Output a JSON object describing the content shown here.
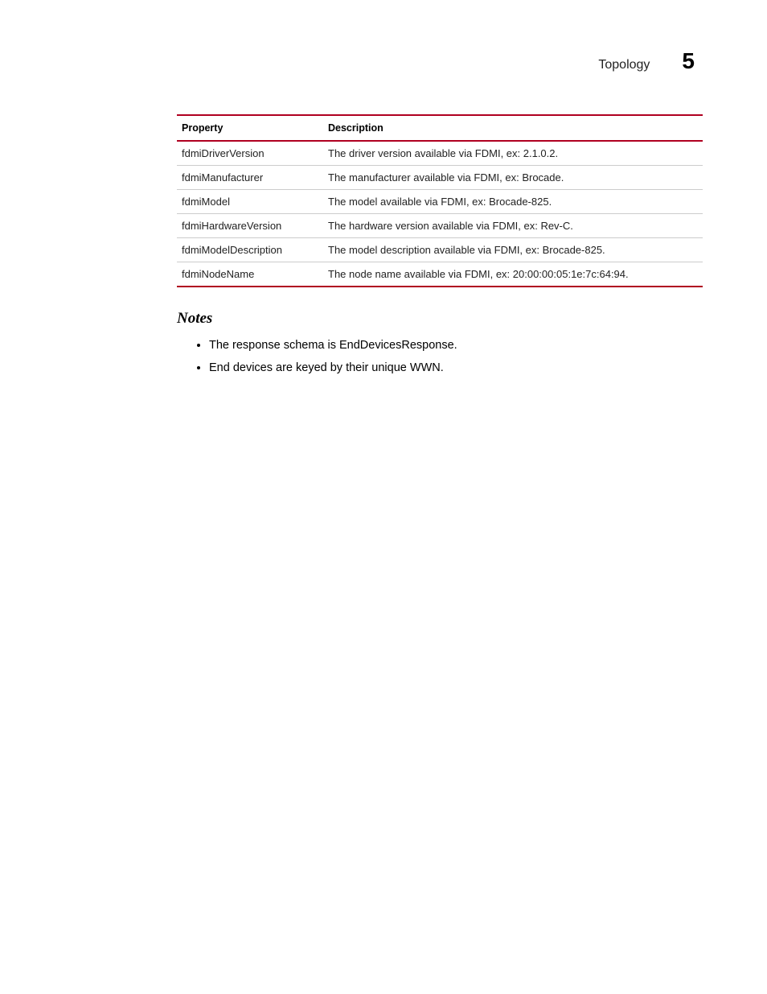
{
  "header": {
    "title": "Topology",
    "chapter_number": "5"
  },
  "table": {
    "headers": {
      "property": "Property",
      "description": "Description"
    },
    "rows": [
      {
        "property": "fdmiDriverVersion",
        "description": "The driver version available via FDMI, ex: 2.1.0.2."
      },
      {
        "property": "fdmiManufacturer",
        "description": "The manufacturer available via FDMI, ex: Brocade."
      },
      {
        "property": "fdmiModel",
        "description": "The model available via FDMI, ex: Brocade-825."
      },
      {
        "property": "fdmiHardwareVersion",
        "description": "The hardware version available via FDMI, ex: Rev-C."
      },
      {
        "property": "fdmiModelDescription",
        "description": "The model description available via FDMI, ex: Brocade-825."
      },
      {
        "property": "fdmiNodeName",
        "description": "The node name available via FDMI, ex: 20:00:00:05:1e:7c:64:94."
      }
    ]
  },
  "notes": {
    "heading": "Notes",
    "items": [
      "The response schema is EndDevicesResponse.",
      "End devices are keyed by their unique WWN."
    ]
  }
}
